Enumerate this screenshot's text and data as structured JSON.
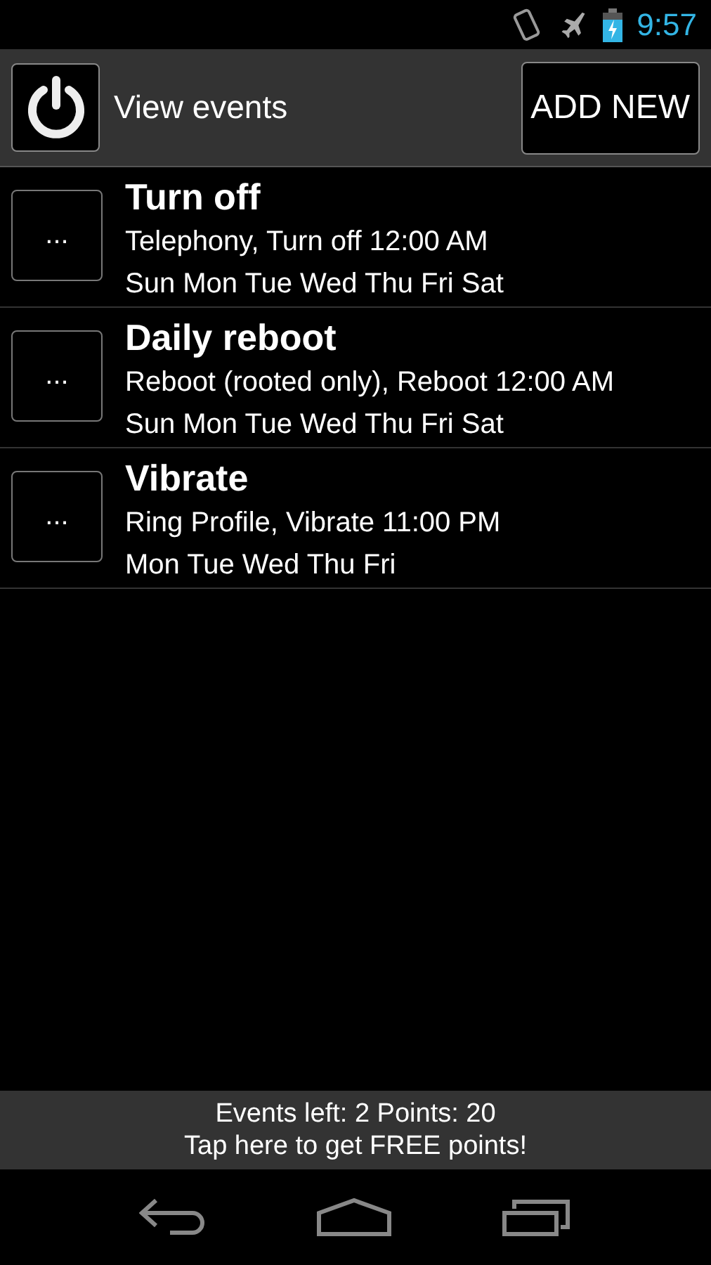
{
  "status_bar": {
    "time": "9:57"
  },
  "header": {
    "title": "View events",
    "add_button": "ADD NEW"
  },
  "events": [
    {
      "menu": "...",
      "title": "Turn off",
      "action": "Telephony, Turn off 12:00 AM",
      "days": "Sun Mon Tue Wed Thu Fri Sat"
    },
    {
      "menu": "...",
      "title": "Daily reboot",
      "action": "Reboot (rooted only), Reboot 12:00 AM",
      "days": "Sun Mon Tue Wed Thu Fri Sat"
    },
    {
      "menu": "...",
      "title": "Vibrate",
      "action": "Ring Profile, Vibrate 11:00 PM",
      "days": "Mon Tue Wed Thu Fri"
    }
  ],
  "footer": {
    "stats": "Events left: 2 Points: 20",
    "offer": "Tap here to get FREE points!"
  }
}
